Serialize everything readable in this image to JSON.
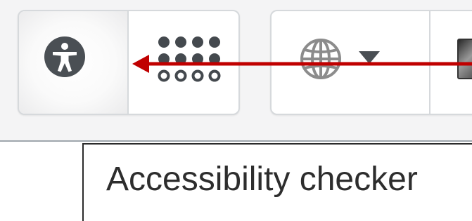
{
  "toolbar": {
    "accessibility_button": {
      "icon": "accessibility-person-icon",
      "icon_color": "#4a4f54"
    },
    "apps_button": {
      "icon": "apps-grid-icon",
      "icon_color": "#44494e"
    },
    "language_button": {
      "icon": "globe-icon",
      "dropdown_icon": "caret-down-icon",
      "icon_color": "#8c8c8c",
      "caret_color": "#4a4f54"
    },
    "user_menu": {
      "icon": "user-avatar"
    }
  },
  "annotation": {
    "icon": "arrow-left-icon",
    "color": "#c00000"
  },
  "tooltip": {
    "text": "Accessibility checker"
  }
}
